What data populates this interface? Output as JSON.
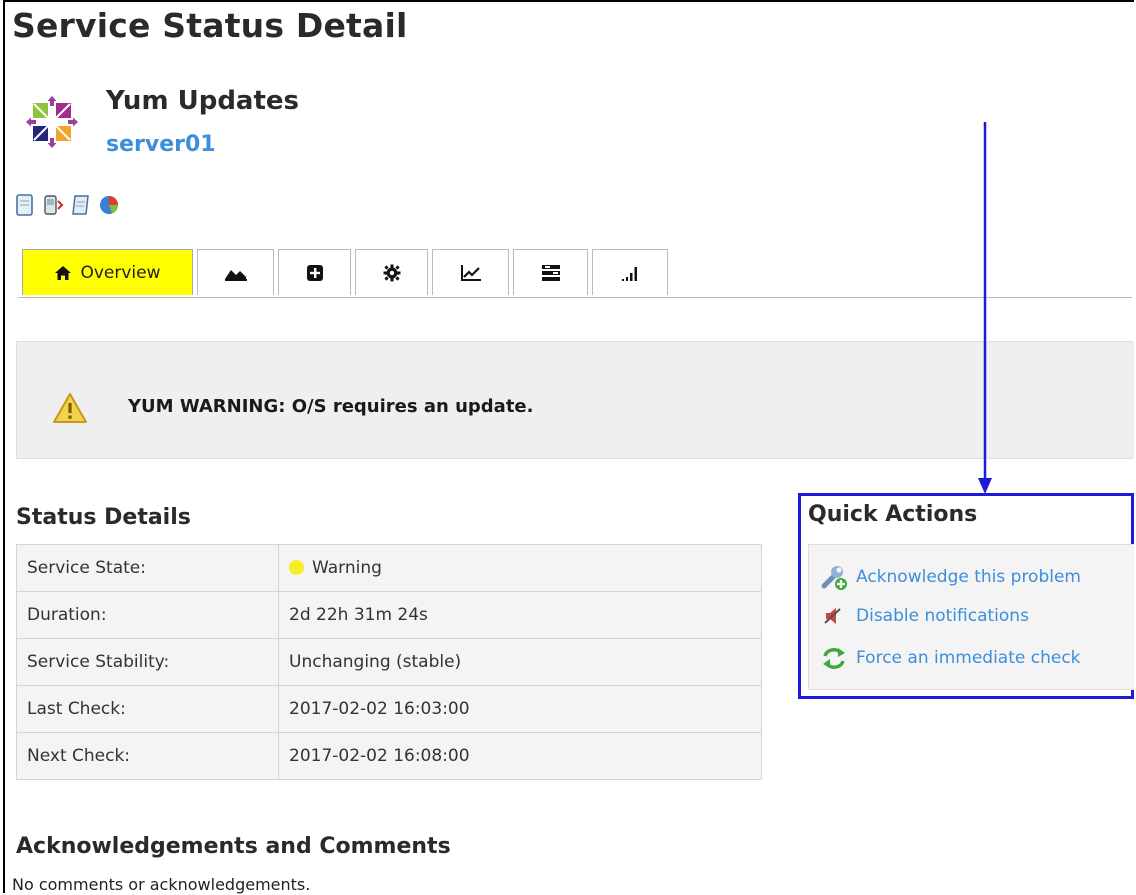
{
  "page": {
    "title": "Service Status Detail"
  },
  "service": {
    "name": "Yum Updates",
    "host": "server01"
  },
  "header_icons": [
    "document-icon",
    "phone-alert-icon",
    "notes-icon",
    "pie-chart-icon"
  ],
  "tabs": [
    {
      "label": "Overview",
      "icon": "home-icon",
      "active": true
    },
    {
      "label": "",
      "icon": "area-chart-icon"
    },
    {
      "label": "",
      "icon": "plus-square-icon"
    },
    {
      "label": "",
      "icon": "gear-icon"
    },
    {
      "label": "",
      "icon": "line-chart-icon"
    },
    {
      "label": "",
      "icon": "list-bars-icon"
    },
    {
      "label": "",
      "icon": "signal-bars-icon"
    }
  ],
  "banner": {
    "icon": "warning-icon",
    "text": "YUM WARNING: O/S requires an update."
  },
  "status_details": {
    "heading": "Status Details",
    "rows": [
      {
        "label": "Service State:",
        "value": "Warning",
        "state_color": "#f6ec2a"
      },
      {
        "label": "Duration:",
        "value": "2d 22h 31m 24s"
      },
      {
        "label": "Service Stability:",
        "value": "Unchanging (stable)"
      },
      {
        "label": "Last Check:",
        "value": "2017-02-02 16:03:00"
      },
      {
        "label": "Next Check:",
        "value": "2017-02-02 16:08:00"
      }
    ]
  },
  "quick_actions": {
    "heading": "Quick Actions",
    "items": [
      {
        "label": "Acknowledge this problem",
        "icon": "wrench-icon"
      },
      {
        "label": "Disable notifications",
        "icon": "mute-icon"
      },
      {
        "label": "Force an immediate check",
        "icon": "refresh-icon"
      }
    ]
  },
  "comments": {
    "heading": "Acknowledgements and Comments",
    "empty_text": "No comments or acknowledgements."
  },
  "colors": {
    "active_tab": "#ffff00",
    "link": "#3d8edb",
    "highlight_box": "#1b1bd9"
  }
}
